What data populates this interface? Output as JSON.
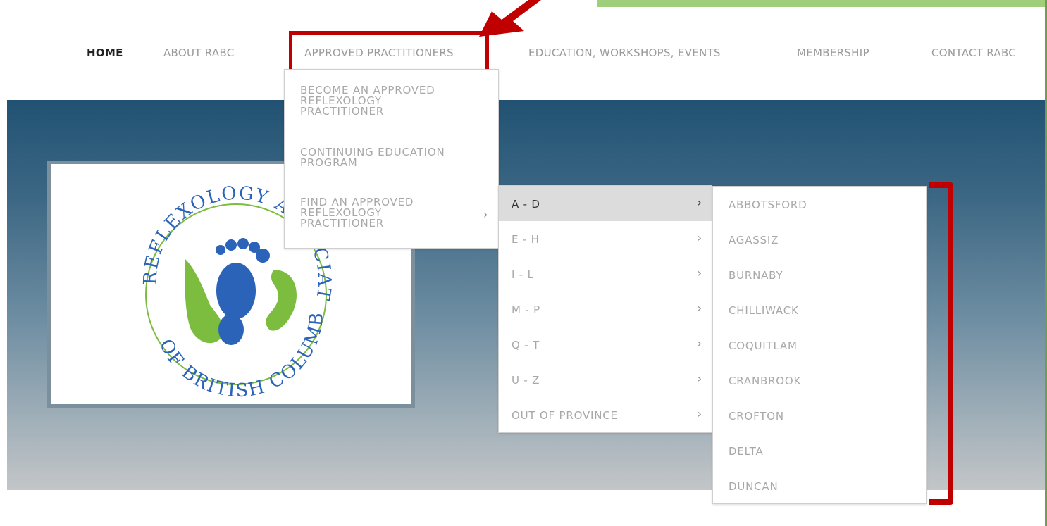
{
  "nav": {
    "items": [
      {
        "label": "HOME",
        "active": true
      },
      {
        "label": "ABOUT RABC"
      },
      {
        "label": "APPROVED PRACTITIONERS"
      },
      {
        "label": "EDUCATION, WORKSHOPS, EVENTS"
      },
      {
        "label": "MEMBERSHIP"
      },
      {
        "label": "CONTACT RABC"
      }
    ]
  },
  "dropdown": {
    "items": [
      {
        "label": "BECOME AN APPROVED\nREFLEXOLOGY\nPRACTITIONER"
      },
      {
        "label": "CONTINUING EDUCATION\nPROGRAM"
      },
      {
        "label": "FIND AN APPROVED\nREFLEXOLOGY\nPRACTITIONER",
        "chevron": "›"
      }
    ]
  },
  "submenu": {
    "items": [
      {
        "label": "A - D",
        "chevron": "›",
        "selected": true
      },
      {
        "label": "E - H",
        "chevron": "›"
      },
      {
        "label": "I - L",
        "chevron": "›"
      },
      {
        "label": "M - P",
        "chevron": "›"
      },
      {
        "label": "Q - T",
        "chevron": "›"
      },
      {
        "label": "U - Z",
        "chevron": "›"
      },
      {
        "label": "OUT OF PROVINCE",
        "chevron": "›"
      }
    ]
  },
  "cities": {
    "items": [
      "ABBOTSFORD",
      "AGASSIZ",
      "BURNABY",
      "CHILLIWACK",
      "COQUITLAM",
      "CRANBROOK",
      "CROFTON",
      "DELTA",
      "DUNCAN"
    ]
  },
  "logo": {
    "top_text": "REFLEXOLOGY ASSOCIATION",
    "bottom_text": "OF BRITISH COLUMBIA"
  },
  "colors": {
    "annotation_red": "#c00000",
    "accent_green": "#9fcf7a",
    "logo_blue": "#2a63b8",
    "logo_green": "#7cbd3f"
  }
}
